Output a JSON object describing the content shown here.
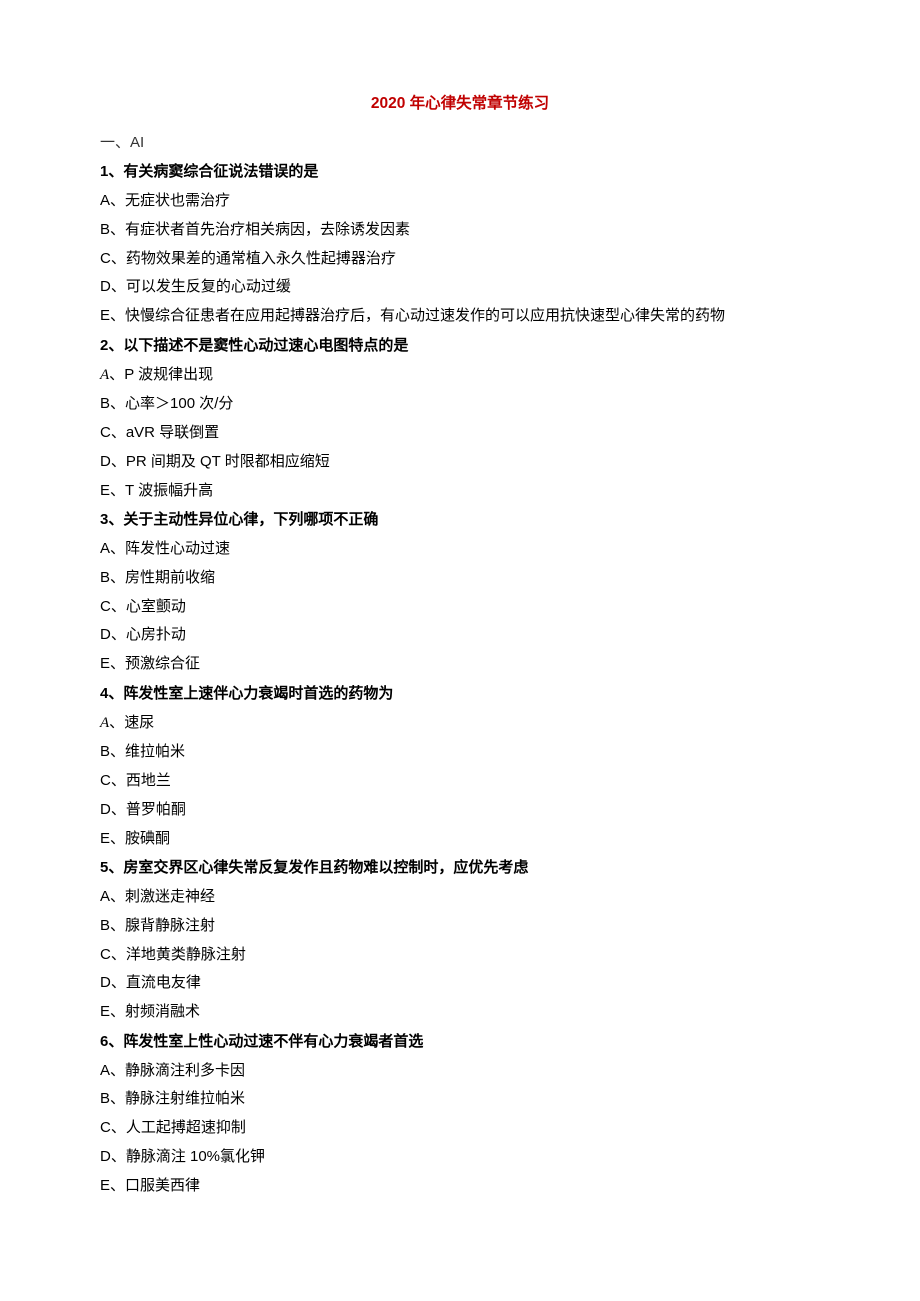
{
  "title": "2020 年心律失常章节练习",
  "section_label": "一、AI",
  "questions": [
    {
      "stem": "1、有关病窦综合征说法错误的是",
      "options": [
        "A、无症状也需治疗",
        "B、有症状者首先治疗相关病因，去除诱发因素",
        "C、药物效果差的通常植入永久性起搏器治疗",
        "D、可以发生反复的心动过缓",
        "E、快慢综合征患者在应用起搏器治疗后，有心动过速发作的可以应用抗快速型心律失常的药物"
      ],
      "italic_first": false
    },
    {
      "stem": "2、以下描述不是窦性心动过速心电图特点的是",
      "options": [
        "A、P 波规律出现",
        "B、心率＞100 次/分",
        "C、aVR 导联倒置",
        "D、PR 间期及 QT 时限都相应缩短",
        "E、T 波振幅升高"
      ],
      "italic_first": true
    },
    {
      "stem": "3、关于主动性异位心律，下列哪项不正确",
      "options": [
        "A、阵发性心动过速",
        "B、房性期前收缩",
        "C、心室颤动",
        "D、心房扑动",
        "E、预激综合征"
      ],
      "italic_first": false
    },
    {
      "stem": "4、阵发性室上速伴心力衰竭时首选的药物为",
      "options": [
        "A、速尿",
        "B、维拉帕米",
        "C、西地兰",
        "D、普罗帕酮",
        "E、胺碘酮"
      ],
      "italic_first": true
    },
    {
      "stem": "5、房室交界区心律失常反复发作且药物难以控制时，应优先考虑",
      "options": [
        "A、刺激迷走神经",
        "B、腺背静脉注射",
        "C、洋地黄类静脉注射",
        "D、直流电友律",
        "E、射频消融术"
      ],
      "italic_first": false
    },
    {
      "stem": "6、阵发性室上性心动过速不伴有心力衰竭者首选",
      "options": [
        "A、静脉滴注利多卡因",
        "B、静脉注射维拉帕米",
        "C、人工起搏超速抑制",
        "D、静脉滴注 10%氯化钾",
        "E、口服美西律"
      ],
      "italic_first": false
    }
  ]
}
